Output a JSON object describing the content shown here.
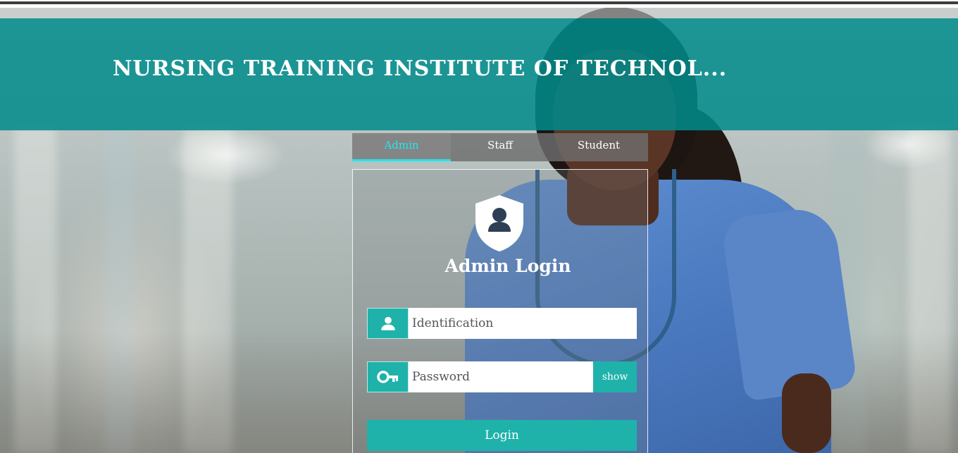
{
  "header": {
    "title": "NURSING TRAINING INSTITUTE OF TECHNOL..."
  },
  "tabs": [
    {
      "label": "Admin",
      "active": true
    },
    {
      "label": "Staff",
      "active": false
    },
    {
      "label": "Student",
      "active": false
    }
  ],
  "login": {
    "title": "Admin Login",
    "icon": "admin-shield-icon",
    "identification": {
      "placeholder": "Identification",
      "value": "",
      "icon": "user-icon"
    },
    "password": {
      "placeholder": "Password",
      "value": "",
      "icon": "key-icon",
      "toggle_label": "show"
    },
    "submit_label": "Login"
  },
  "colors": {
    "header_band": "#008a8a",
    "accent": "#1fb2aa",
    "active_tab": "#22e6f0"
  }
}
